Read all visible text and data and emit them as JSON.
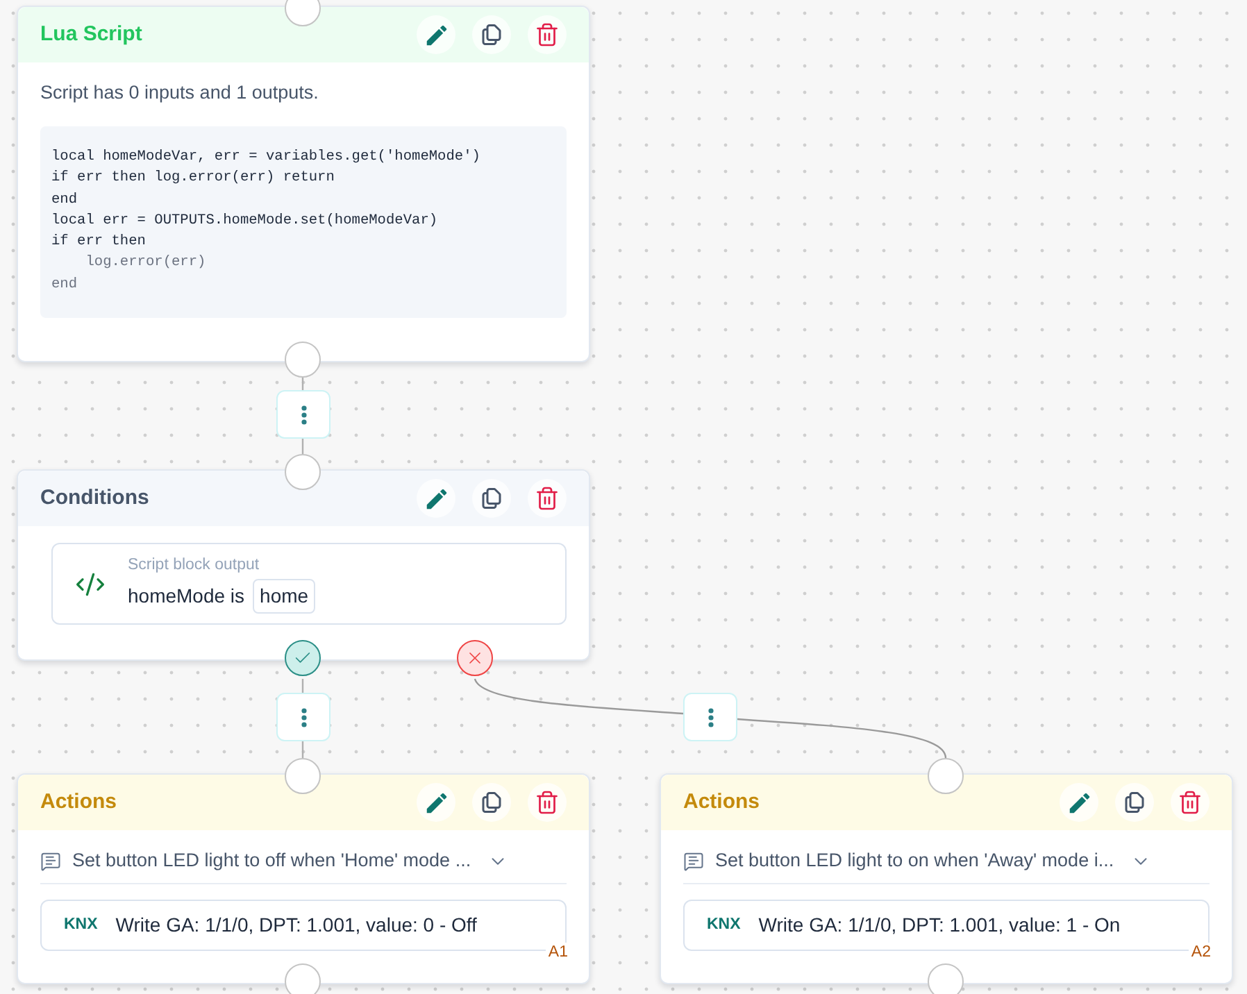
{
  "nodes": [
    {
      "kind": "script",
      "title": "Lua Script",
      "summary": "Script has 0 inputs and 1 outputs.",
      "code": [
        {
          "text": "local homeModeVar, err = variables.get('homeMode')",
          "faded": false
        },
        {
          "text": "if err then log.error(err) return",
          "faded": false
        },
        {
          "text": "end",
          "faded": false
        },
        {
          "text": "local err = OUTPUTS.homeMode.set(homeModeVar)",
          "faded": false
        },
        {
          "text": "if err then",
          "faded": false
        },
        {
          "text": "    log.error(err)",
          "faded": true
        },
        {
          "text": "end",
          "faded": true
        }
      ]
    },
    {
      "kind": "conditions",
      "title": "Conditions",
      "conditions": [
        {
          "source": "Script block output",
          "subject": "homeMode is",
          "value": "home"
        }
      ],
      "outputs": [
        {
          "kind": "true"
        },
        {
          "kind": "false"
        }
      ]
    },
    {
      "kind": "actions",
      "title": "Actions",
      "description": "Set button LED light to off when 'Home' mode ...",
      "expanded": false,
      "actions": [
        {
          "protocol": "KNX",
          "text": "Write GA: 1/1/0, DPT: 1.001, value: 0 - Off",
          "tag": "A1"
        }
      ]
    },
    {
      "kind": "actions",
      "title": "Actions",
      "description": "Set button LED light to on when 'Away' mode i...",
      "expanded": false,
      "actions": [
        {
          "protocol": "KNX",
          "text": "Write GA: 1/1/0, DPT: 1.001, value: 1 - On",
          "tag": "A2"
        }
      ]
    }
  ]
}
